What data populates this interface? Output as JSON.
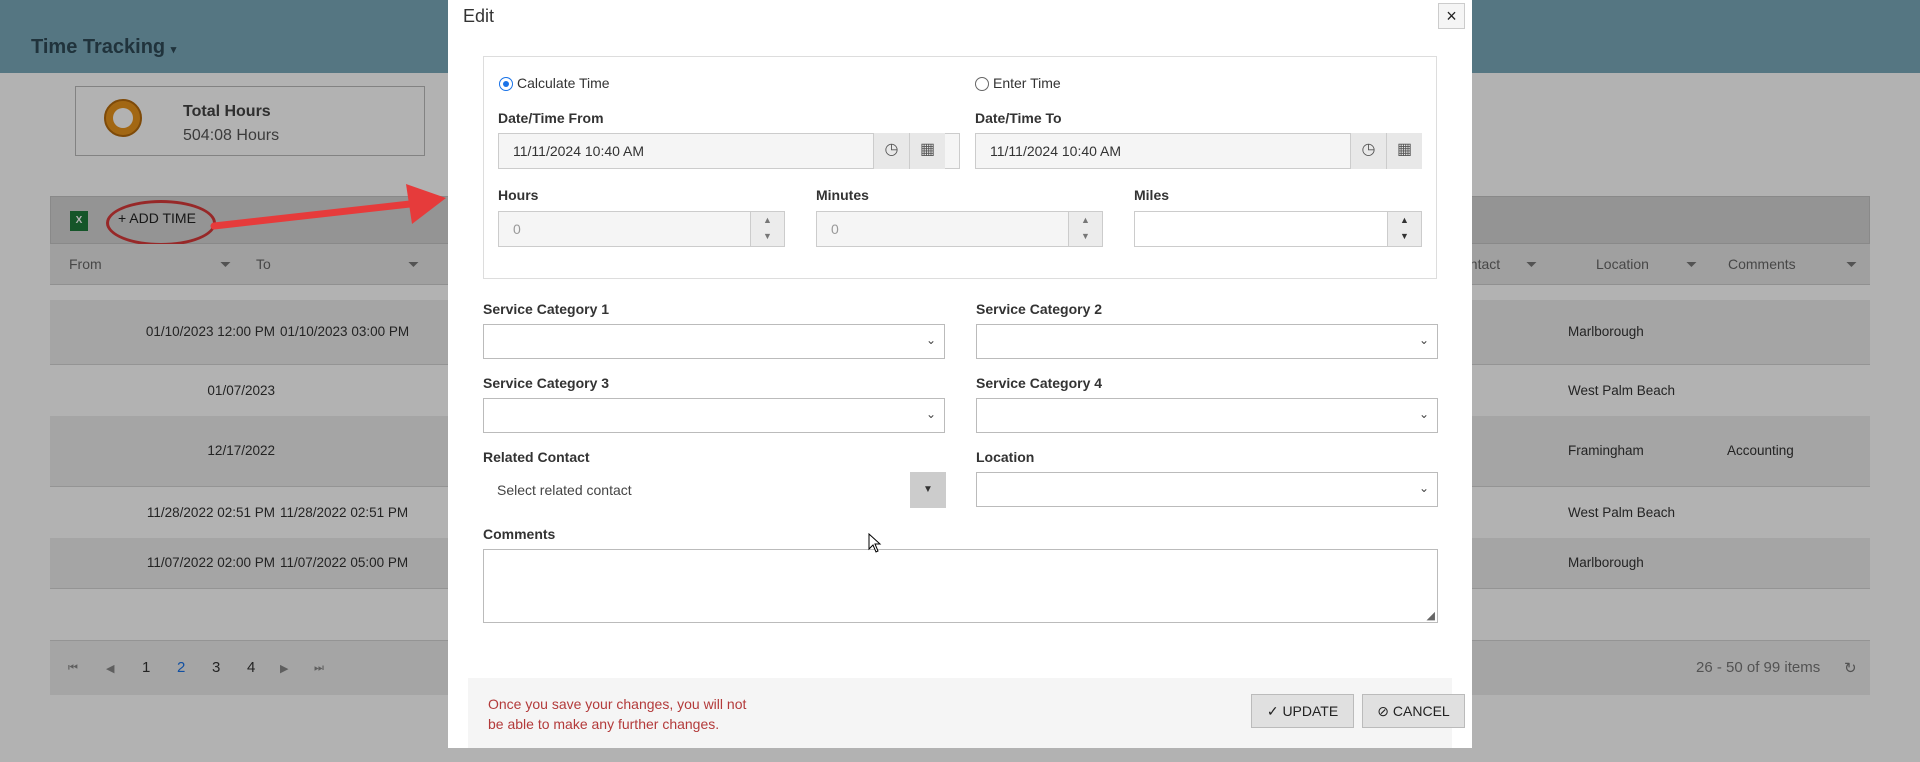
{
  "app": {
    "title": "Time Tracking",
    "title_chevron": "chevron-down"
  },
  "summary": {
    "label": "Total Hours",
    "value": "504:08 Hours"
  },
  "toolbar": {
    "add_time_label": "+ ADD TIME"
  },
  "grid": {
    "columns": [
      "From",
      "To",
      "ontact",
      "Location",
      "Comments"
    ],
    "rows": [
      {
        "from": "01/10/2023 12:00 PM",
        "to": "01/10/2023 03:00 PM",
        "location": "Marlborough",
        "comments": ""
      },
      {
        "from": "01/07/2023",
        "to": "",
        "location": "West Palm Beach",
        "comments": ""
      },
      {
        "from": "12/17/2022",
        "to": "",
        "location": "Framingham",
        "comments": "Accounting"
      },
      {
        "from": "11/28/2022 02:51 PM",
        "to": "11/28/2022 02:51 PM",
        "location": "West Palm Beach",
        "comments": ""
      },
      {
        "from": "11/07/2022 02:00 PM",
        "to": "11/07/2022 05:00 PM",
        "location": "Marlborough",
        "comments": ""
      }
    ],
    "pager": {
      "pages": [
        "1",
        "2",
        "3",
        "4"
      ],
      "current": "2",
      "info": "26 - 50 of 99 items"
    }
  },
  "modal": {
    "title": "Edit",
    "close": "×",
    "mode_calculate": "Calculate Time",
    "mode_enter": "Enter Time",
    "from_label": "Date/Time From",
    "from_value": "11/11/2024 10:40 AM",
    "to_label": "Date/Time To",
    "to_value": "11/11/2024 10:40 AM",
    "hours_label": "Hours",
    "hours_value": "0",
    "minutes_label": "Minutes",
    "minutes_value": "0",
    "miles_label": "Miles",
    "miles_value": "",
    "svc1_label": "Service Category 1",
    "svc2_label": "Service Category 2",
    "svc3_label": "Service Category 3",
    "svc4_label": "Service Category 4",
    "contact_label": "Related Contact",
    "contact_placeholder": "Select related contact",
    "location_label": "Location",
    "comments_label": "Comments",
    "warning_line1": "Once you save your changes, you will not",
    "warning_line2": "be able to make any further changes.",
    "update_label": "UPDATE",
    "cancel_label": "CANCEL"
  }
}
